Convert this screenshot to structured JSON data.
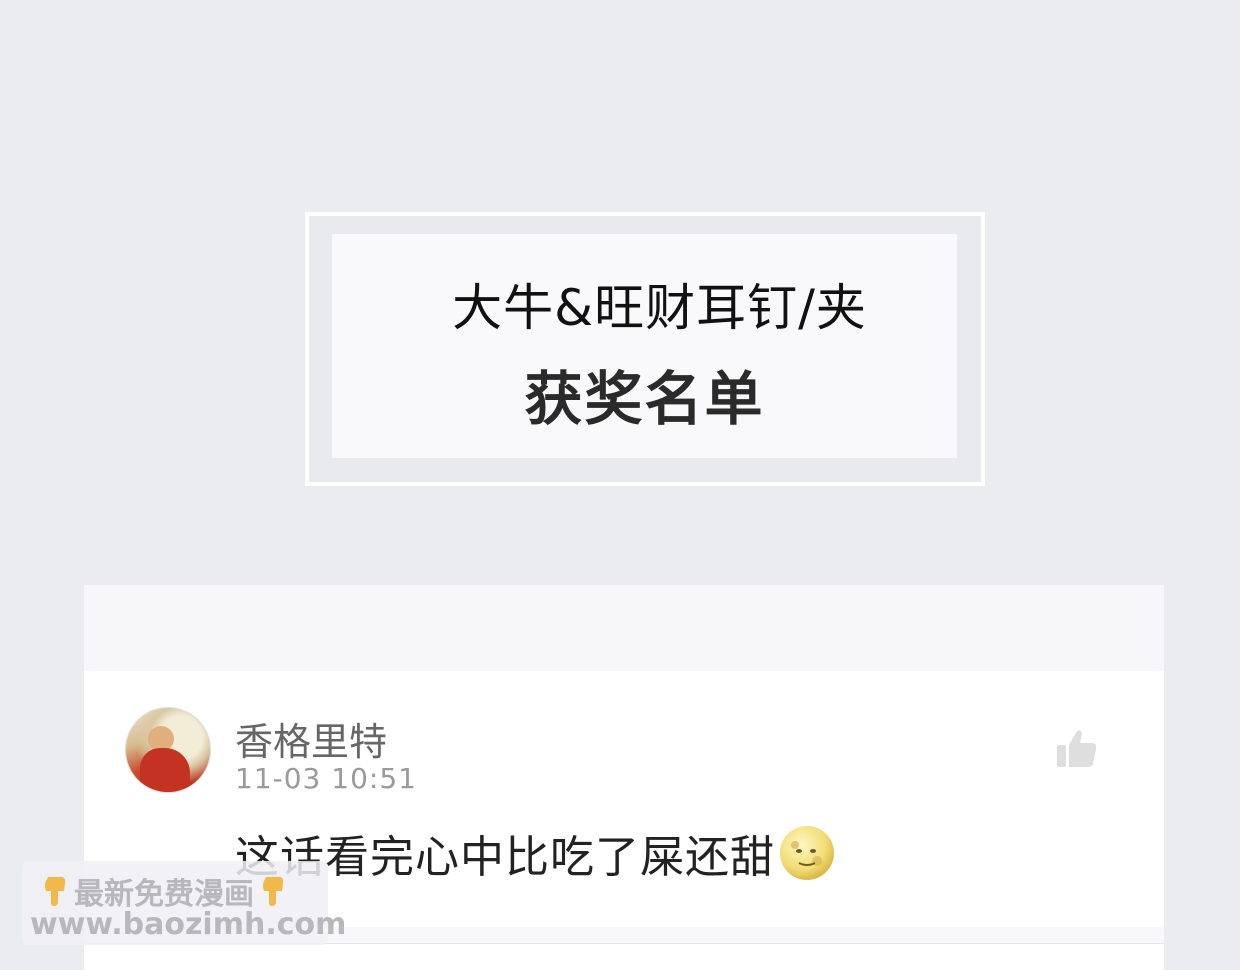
{
  "banner": {
    "title_line1": "大牛&旺财耳钉/夹",
    "title_line2": "获奖名单"
  },
  "comment": {
    "username": "香格里特",
    "timestamp": "11-03 10:51",
    "text": "这话看完心中比吃了屎还甜",
    "emoji": "full-moon-face-icon"
  },
  "watermark": {
    "line1": "最新免费漫画",
    "line2": "www.baozimh.com"
  }
}
